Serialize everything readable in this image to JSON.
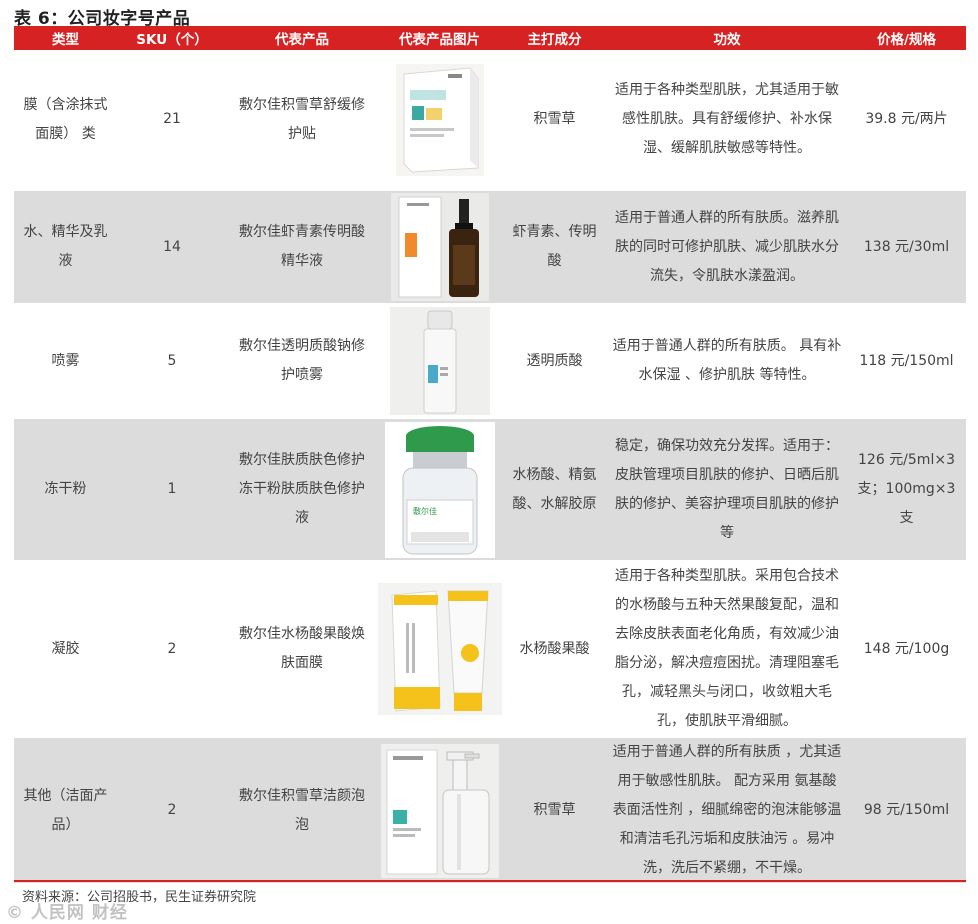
{
  "title": "表 6：公司妆字号产品",
  "headers": [
    "类型",
    "SKU（个）",
    "代表产品",
    "代表产品图片",
    "主打成分",
    "功效",
    "价格/规格"
  ],
  "rows": [
    {
      "type": "膜（含涂抹式面膜） 类",
      "sku": "21",
      "product": "敷尔佳积雪草舒缓修护贴",
      "ingredient": "积雪草",
      "effect": "适用于各种类型肌肤，尤其适用于敏感性肌肤。具有舒缓修护、补水保湿、缓解肌肤敏感等特性。",
      "price": "39.8 元/两片",
      "image_icon": "mask-box-image"
    },
    {
      "type": "水、精华及乳液",
      "sku": "14",
      "product": "敷尔佳虾青素传明酸精华液",
      "ingredient": "虾青素、传明酸",
      "effect": "适用于普通人群的所有肤质。滋养肌肤的同时可修护肌肤、减少肌肤水分流失，令肌肤水漾盈润。",
      "price": "138 元/30ml",
      "image_icon": "serum-bottle-image"
    },
    {
      "type": "喷雾",
      "sku": "5",
      "product": "敷尔佳透明质酸钠修护喷雾",
      "ingredient": "透明质酸",
      "effect": "适用于普通人群的所有肤质。 具有补水保湿 、修护肌肤 等特性。",
      "price": "118 元/150ml",
      "image_icon": "spray-bottle-image"
    },
    {
      "type": "冻干粉",
      "sku": "1",
      "product": "敷尔佳肤质肤色修护冻干粉肤质肤色修护液",
      "ingredient": "水杨酸、精氨酸、水解胶原",
      "effect": "稳定，确保功效充分发挥。适用于：皮肤管理项目肌肤的修护、日晒后肌肤的修护、美容护理项目肌肤的修护等",
      "price": "126 元/5ml×3支；100mg×3支",
      "image_icon": "freeze-dried-vial-image",
      "vial_label": "敷尔佳 "
    },
    {
      "type": "凝胶",
      "sku": "2",
      "product": "敷尔佳水杨酸果酸焕肤面膜",
      "ingredient": "水杨酸果酸",
      "effect": "适用于各种类型肌肤。采用包合技术的水杨酸与五种天然果酸复配，温和去除皮肤表面老化角质，有效减少油脂分泌，解决痘痘困扰。清理阻塞毛孔，减轻黑头与闭口，收敛粗大毛孔，使肌肤平滑细腻。",
      "price": "148 元/100g",
      "image_icon": "gel-tube-image"
    },
    {
      "type": "其他（洁面产品）",
      "sku": "2",
      "product": "敷尔佳积雪草洁颜泡泡",
      "ingredient": "积雪草",
      "effect": "适用于普通人群的所有肤质 ，尤其适用于敏感性肌肤。 配方采用 氨基酸表面活性剂 ，细腻绵密的泡沫能够温和清洁毛孔污垢和皮肤油污 。易冲洗，洗后不紧绷，不干燥。",
      "price": "98 元/150ml",
      "image_icon": "foam-pump-image"
    }
  ],
  "source": "资料来源：公司招股书，民生证券研究院",
  "watermark": "© 人民网 财经",
  "accent_color": "#d62223",
  "shade_color": "#dcdcdc"
}
